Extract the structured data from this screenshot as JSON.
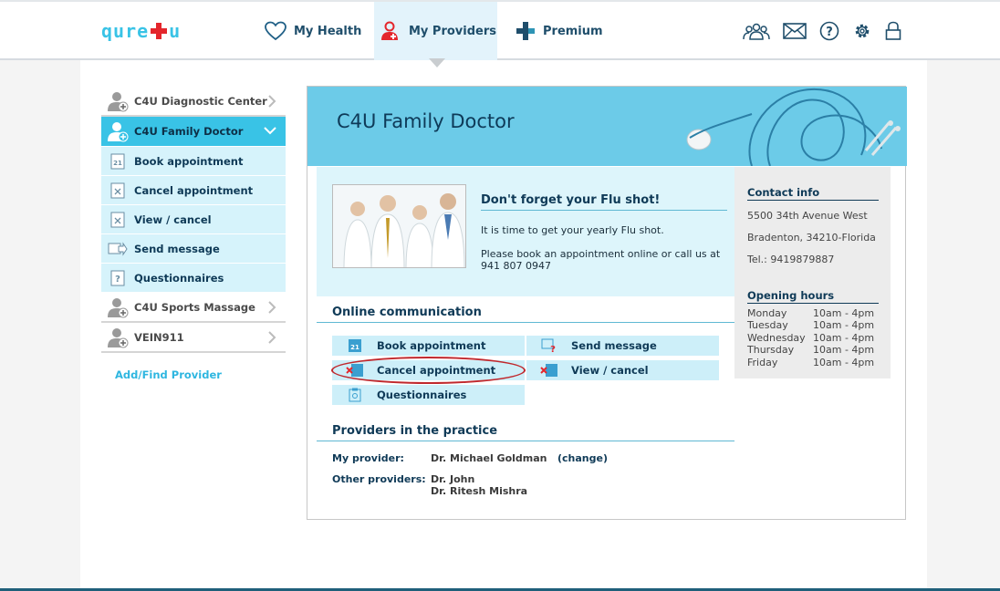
{
  "header": {
    "logo_text_left": "qure",
    "logo_text_right": "u",
    "tabs": [
      {
        "label": "My Health",
        "icon": "heart-icon"
      },
      {
        "label": "My Providers",
        "icon": "doctor-icon"
      },
      {
        "label": "Premium",
        "icon": "premium-plus-icon"
      }
    ],
    "tool_icons": [
      "group-icon",
      "mail-icon",
      "help-icon",
      "gear-icon",
      "lock-icon"
    ]
  },
  "sidebar": {
    "providers": [
      {
        "label": "C4U Diagnostic Center"
      },
      {
        "label": "C4U Family Doctor"
      },
      {
        "label": "C4U Sports Massage"
      },
      {
        "label": "VEIN911"
      }
    ],
    "subitems": [
      {
        "label": "Book appointment",
        "icon": "calendar-icon"
      },
      {
        "label": "Cancel appointment",
        "icon": "cancel-doc-icon"
      },
      {
        "label": "View / cancel",
        "icon": "view-doc-icon"
      },
      {
        "label": "Send message",
        "icon": "send-icon"
      },
      {
        "label": "Questionnaires",
        "icon": "question-icon"
      }
    ],
    "add_provider": "Add/Find Provider"
  },
  "main": {
    "banner_title": "C4U Family Doctor",
    "flu": {
      "title": "Don't forget your Flu shot!",
      "text1": "It is time to get your yearly Flu shot.",
      "text2": "Please book an appointment online or call us at 941 807 0947"
    },
    "online_title": "Online communication",
    "buttons": {
      "book": "Book appointment",
      "send": "Send message",
      "cancel": "Cancel appointment",
      "view": "View / cancel",
      "questionnaires": "Questionnaires"
    },
    "providers_title": "Providers in the practice",
    "my_provider_label": "My provider:",
    "my_provider_name": "Dr. Michael Goldman",
    "change_link": "(change)",
    "other_label": "Other providers:",
    "other_1": "Dr. John",
    "other_2": "Dr. Ritesh Mishra"
  },
  "contact": {
    "title": "Contact info",
    "address1": "5500 34th Avenue West",
    "address2": "Bradenton, 34210-Florida",
    "phone": "Tel.: 9419879887",
    "hours_title": "Opening hours",
    "hours": [
      {
        "day": "Monday",
        "time": "10am - 4pm"
      },
      {
        "day": "Tuesday",
        "time": "10am - 4pm"
      },
      {
        "day": "Wednesday",
        "time": "10am - 4pm"
      },
      {
        "day": "Thursday",
        "time": "10am - 4pm"
      },
      {
        "day": "Friday",
        "time": "10am - 4pm"
      }
    ]
  },
  "colors": {
    "accent": "#39c3e6",
    "brand_red": "#e4262c",
    "navy": "#0f3a57",
    "light_blue": "#d6f3fb",
    "highlight_oval": "#c0282d"
  }
}
